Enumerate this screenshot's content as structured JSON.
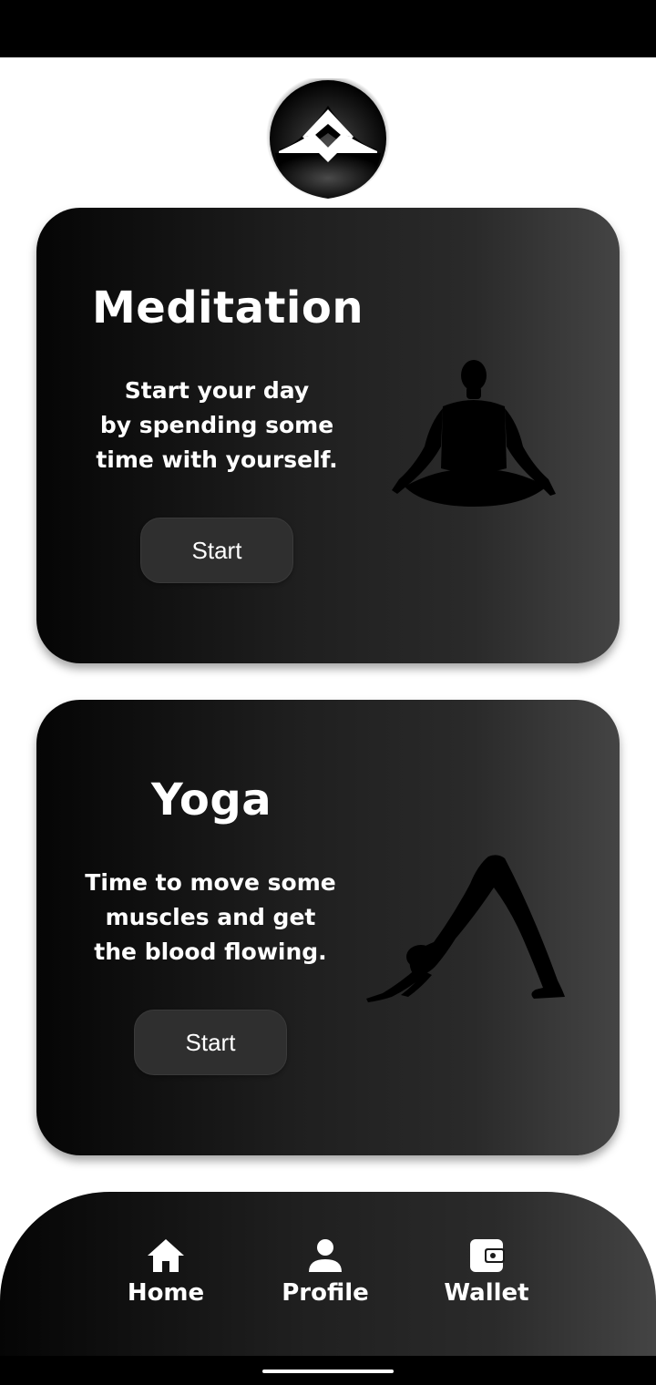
{
  "cards": [
    {
      "title": "Meditation",
      "description": "Start your day\nby spending some\ntime with yourself.",
      "button_label": "Start",
      "figure": "meditation-pose-icon"
    },
    {
      "title": "Yoga",
      "description": "Time to move some\nmuscles and get\nthe blood flowing.",
      "button_label": "Start",
      "figure": "downward-dog-pose-icon"
    }
  ],
  "nav": {
    "items": [
      {
        "label": "Home",
        "icon": "home-icon"
      },
      {
        "label": "Profile",
        "icon": "person-icon"
      },
      {
        "label": "Wallet",
        "icon": "wallet-icon"
      }
    ]
  },
  "colors": {
    "card_gradient_start": "#050505",
    "card_gradient_end": "#444444",
    "button_bg": "#2f2f2f",
    "text": "#ffffff"
  }
}
